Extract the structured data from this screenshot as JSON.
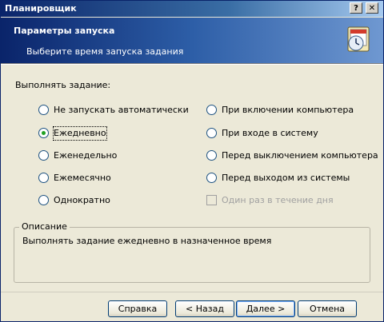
{
  "window": {
    "title": "Планировщик",
    "help_button": "?",
    "close_button": "✕"
  },
  "header": {
    "title": "Параметры запуска",
    "subtitle": "Выберите время запуска задания",
    "icon": "scheduler-icon"
  },
  "schedule": {
    "label": "Выполнять задание:",
    "options_left": [
      {
        "label": "Не запускать автоматически",
        "checked": false
      },
      {
        "label": "Ежедневно",
        "checked": true
      },
      {
        "label": "Еженедельно",
        "checked": false
      },
      {
        "label": "Ежемесячно",
        "checked": false
      },
      {
        "label": "Однократно",
        "checked": false
      }
    ],
    "options_right": [
      {
        "label": "При включении компьютера",
        "checked": false
      },
      {
        "label": "При входе в систему",
        "checked": false
      },
      {
        "label": "Перед выключением компьютера",
        "checked": false
      },
      {
        "label": "Перед выходом из системы",
        "checked": false
      }
    ],
    "once_a_day": {
      "label": "Один раз в течение дня",
      "checked": false,
      "enabled": false
    }
  },
  "description": {
    "legend": "Описание",
    "text": "Выполнять задание ежедневно в назначенное время"
  },
  "buttons": {
    "help": "Справка",
    "back": "< Назад",
    "next": "Далее >",
    "cancel": "Отмена"
  }
}
